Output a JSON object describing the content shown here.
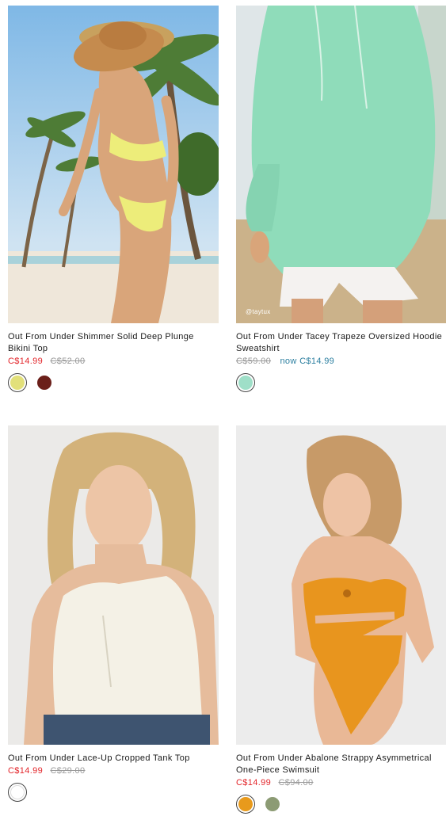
{
  "products": [
    {
      "title": "Out From Under Shimmer Solid Deep Plunge Bikini Top",
      "price_sale": "C$14.99",
      "price_was": "C$52.00",
      "swatches": [
        {
          "color": "#e2e07a",
          "selected": true
        },
        {
          "color": "#6b1f1a",
          "selected": false
        }
      ],
      "image_desc": "yellow-bikini-beach-photo"
    },
    {
      "title": "Out From Under Tacey Trapeze Oversized Hoodie Sweatshirt",
      "price_was": "C$59.00",
      "price_now": "now C$14.99",
      "watermark": "@taytux",
      "swatches": [
        {
          "color": "#9fdfc8",
          "selected": true
        }
      ],
      "image_desc": "mint-hoodie-photo"
    },
    {
      "title": "Out From Under Lace-Up Cropped Tank Top",
      "price_sale": "C$14.99",
      "price_was": "C$29.00",
      "swatches": [
        {
          "color": "#ffffff",
          "selected": true
        }
      ],
      "image_desc": "white-tank-top-photo"
    },
    {
      "title": "Out From Under Abalone Strappy Asymmetrical One-Piece Swimsuit",
      "price_sale": "C$14.99",
      "price_was": "C$94.00",
      "swatches": [
        {
          "color": "#e89a1c",
          "selected": true
        },
        {
          "color": "#8c9b74",
          "selected": false
        }
      ],
      "image_desc": "orange-swimsuit-photo"
    }
  ]
}
